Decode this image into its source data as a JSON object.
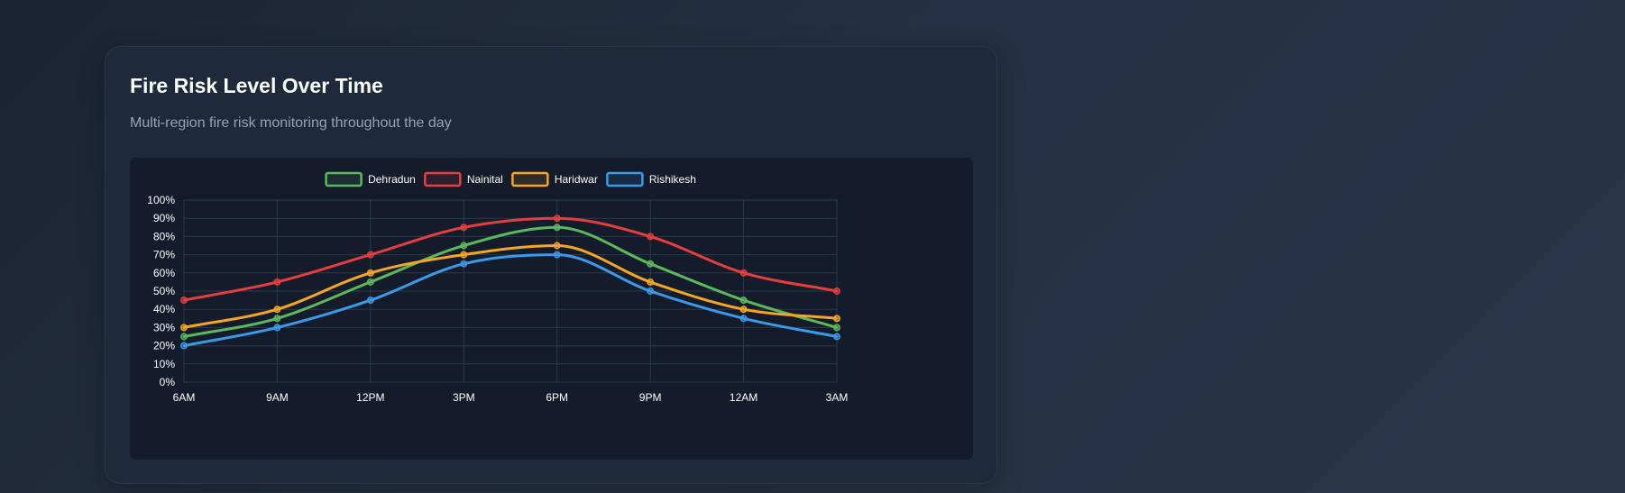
{
  "card": {
    "title": "Fire Risk Level Over Time",
    "subtitle": "Multi-region fire risk monitoring throughout the day"
  },
  "chart_data": {
    "type": "line",
    "categories": [
      "6AM",
      "9AM",
      "12PM",
      "3PM",
      "6PM",
      "9PM",
      "12AM",
      "3AM"
    ],
    "series": [
      {
        "name": "Dehradun",
        "color": "#5cb85c",
        "values": [
          25,
          35,
          55,
          75,
          85,
          65,
          45,
          30
        ]
      },
      {
        "name": "Nainital",
        "color": "#e53e3e",
        "values": [
          45,
          55,
          70,
          85,
          90,
          80,
          60,
          50
        ]
      },
      {
        "name": "Haridwar",
        "color": "#f5a623",
        "values": [
          30,
          40,
          60,
          70,
          75,
          55,
          40,
          35
        ]
      },
      {
        "name": "Rishikesh",
        "color": "#3b9ae8",
        "values": [
          20,
          30,
          45,
          65,
          70,
          50,
          35,
          25
        ]
      }
    ],
    "yticks": [
      "0%",
      "10%",
      "20%",
      "30%",
      "40%",
      "50%",
      "60%",
      "70%",
      "80%",
      "90%",
      "100%"
    ],
    "ylim": [
      0,
      100
    ],
    "grid": true,
    "legend_position": "top-center",
    "curve": "smooth"
  }
}
